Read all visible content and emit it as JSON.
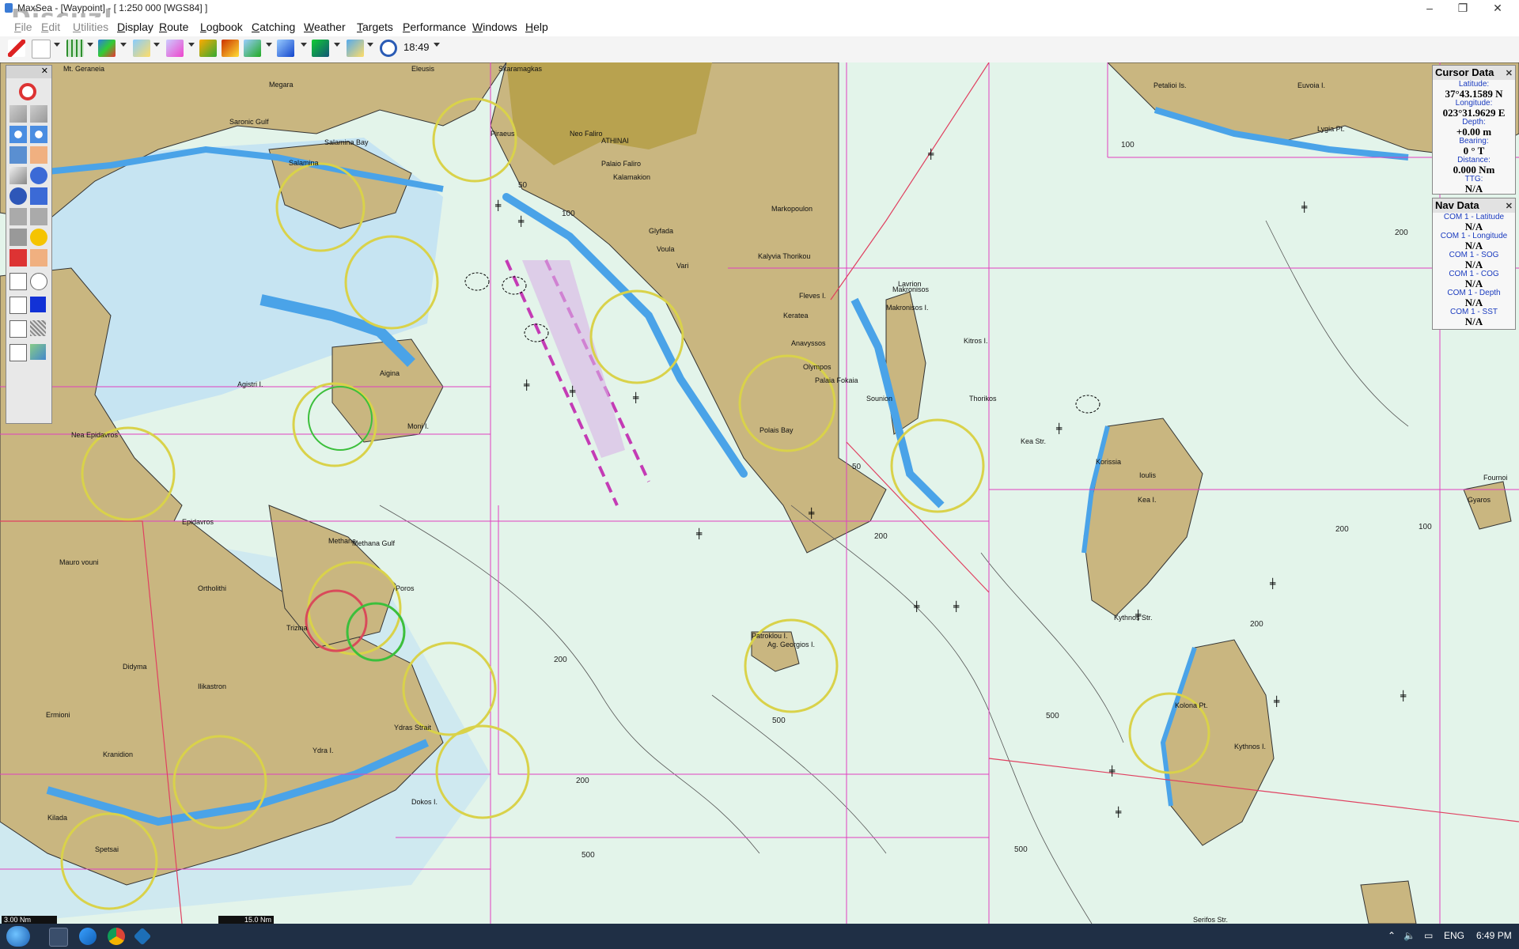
{
  "window": {
    "title": "MaxSea - [Waypoint] - [ 1:250 000 [WGS84] ]",
    "watermark": "Discuz!",
    "controls": [
      "–",
      "❐",
      "✕"
    ]
  },
  "menu": [
    {
      "label": "File"
    },
    {
      "label": "Edit"
    },
    {
      "label": "Utilities"
    },
    {
      "label": "Display"
    },
    {
      "label": "Route"
    },
    {
      "label": "Logbook"
    },
    {
      "label": "Catching"
    },
    {
      "label": "Weather"
    },
    {
      "label": "Targets"
    },
    {
      "label": "Performance"
    },
    {
      "label": "Windows"
    },
    {
      "label": "Help"
    }
  ],
  "toolbar": {
    "time": "18:49"
  },
  "cursor_data": {
    "title": "Cursor Data",
    "fields": [
      {
        "label": "Latitude:",
        "value": "37°43.1589 N"
      },
      {
        "label": "Longitude:",
        "value": "023°31.9629 E"
      },
      {
        "label": "Depth:",
        "value": "+0.00 m"
      },
      {
        "label": "Bearing:",
        "value": "0 ° T"
      },
      {
        "label": "Distance:",
        "value": "0.000 Nm"
      },
      {
        "label": "TTG:",
        "value": "N/A"
      }
    ]
  },
  "nav_data": {
    "title": "Nav Data",
    "fields": [
      {
        "label": "COM 1 - Latitude",
        "value": "N/A"
      },
      {
        "label": "COM 1 - Longitude",
        "value": "N/A"
      },
      {
        "label": "COM 1 - SOG",
        "value": "N/A"
      },
      {
        "label": "COM 1 - COG",
        "value": "N/A"
      },
      {
        "label": "COM 1 - Depth",
        "value": "N/A"
      },
      {
        "label": "COM 1 - SST",
        "value": "N/A"
      }
    ]
  },
  "scale": {
    "left": "3.00 Nm",
    "right": "15.0 Nm"
  },
  "map_places": [
    "Mt. Geraneia",
    "Megara",
    "Eleusis",
    "Skaramagkas",
    "Piraeus",
    "ATHINAI",
    "Neo Faliro",
    "Palaio Faliro",
    "Kalamakion",
    "Glyfada",
    "Voula",
    "Vari",
    "Markopoulon",
    "Kalyvia Thorikou",
    "Salamina Bay",
    "Salamina",
    "Aigina",
    "Moni I.",
    "Agistri I.",
    "Methana",
    "Poros",
    "Trizina",
    "Ydra I.",
    "Ydras Strait",
    "Dokos I.",
    "Kea I.",
    "Ioulis",
    "Kythnos I.",
    "Kythnos Str.",
    "Serifos Str.",
    "Makronisos",
    "Lavrion",
    "Sounion",
    "Ag. Georgios I.",
    "Patroklou I.",
    "Saronic Gulf",
    "Epidavros",
    "Nea Epidavros",
    "Ermioni",
    "Spetsai",
    "Kilada",
    "Kranidion",
    "Ilikastron",
    "Didyma",
    "Ortholithi",
    "Mauro vouni",
    "Fleves I.",
    "Kea Str.",
    "Gyaros",
    "Petalioi Is.",
    "Euvoia I.",
    "Makronisos I.",
    "Korissia",
    "Polais Bay",
    "Anavyssos",
    "Olympos",
    "Palaia Fokaia",
    "Keratea",
    "Thorikos",
    "Kitros I.",
    "Methana Gulf",
    "Fournoi",
    "Kolona Pt.",
    "Lygia Pt."
  ],
  "map_depths": [
    "50",
    "100",
    "100",
    "200",
    "200",
    "200",
    "200",
    "200",
    "500",
    "500",
    "500",
    "500",
    "100",
    "200",
    "50"
  ],
  "taskbar": {
    "language": "ENG",
    "time": "6:49 PM"
  },
  "colors": {
    "land": "#c9b680",
    "shallow": "#4aa3e8",
    "mid": "#c6e4f2",
    "deep": "#e3f4ea",
    "magenta": "#e040c0",
    "caution": "#e8e25a"
  }
}
